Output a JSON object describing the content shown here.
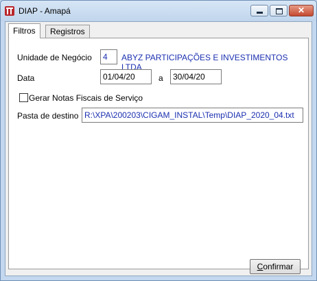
{
  "window": {
    "title": "DIAP - Amapá",
    "icon": "app-logo-icon",
    "controls": {
      "minimize": "minimize-icon",
      "maximize": "maximize-icon",
      "close_glyph": "✕"
    }
  },
  "tabs": [
    {
      "label": "Filtros",
      "active": true
    },
    {
      "label": "Registros",
      "active": false
    }
  ],
  "form": {
    "unidade": {
      "label": "Unidade de Negócio",
      "code": "4",
      "name": "ABYZ PARTICIPAÇÕES E INVESTIMENTOS LTDA"
    },
    "data": {
      "label": "Data",
      "start": "01/04/20",
      "separator": "a",
      "end": "30/04/20"
    },
    "gerar_notas": {
      "label": "Gerar Notas Fiscais de Serviço",
      "checked": false
    },
    "pasta": {
      "label": "Pasta de destino",
      "value": "R:\\XPA\\200203\\CIGAM_INSTAL\\Temp\\DIAP_2020_04.txt"
    }
  },
  "actions": {
    "confirm_rest": "onfirmar",
    "confirm_mnemonic": "C"
  }
}
